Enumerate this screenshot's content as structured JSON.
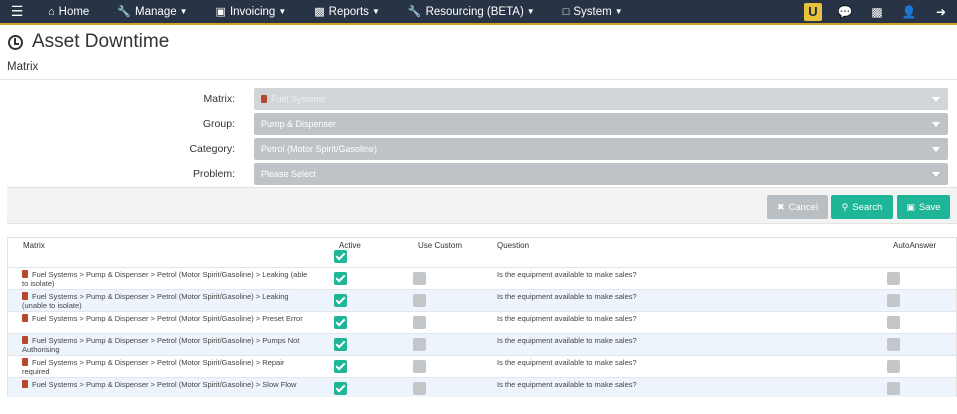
{
  "navbar": {
    "items": [
      {
        "label": "Home",
        "icon": "home-icon",
        "caret": false
      },
      {
        "label": "Manage",
        "icon": "wrench-icon",
        "caret": true
      },
      {
        "label": "Invoicing",
        "icon": "money-icon",
        "caret": true
      },
      {
        "label": "Reports",
        "icon": "bar-chart-icon",
        "caret": true
      },
      {
        "label": "Resourcing (BETA)",
        "icon": "wrench-icon",
        "caret": true
      },
      {
        "label": "System",
        "icon": "monitor-icon",
        "caret": true
      }
    ],
    "right_icons": [
      "logo-u-icon",
      "chat-icon",
      "bar-chart-icon",
      "user-icon",
      "logout-icon"
    ],
    "logo_letter": "U"
  },
  "page": {
    "title": "Asset Downtime",
    "subtitle": "Matrix"
  },
  "form": {
    "matrix_label": "Matrix:",
    "matrix_value": "Fuel Systems",
    "group_label": "Group:",
    "group_value": "Pump & Dispenser",
    "category_label": "Category:",
    "category_value": "Petrol (Motor Spirit/Gasoline)",
    "problem_label": "Problem:",
    "problem_value": "Please Select"
  },
  "actions": {
    "cancel_label": "Cancel",
    "search_label": "Search",
    "save_label": "Save"
  },
  "table": {
    "headers": {
      "matrix": "Matrix",
      "active": "Active",
      "use_custom": "Use Custom",
      "question": "Question",
      "autoanswer": "AutoAnswer"
    },
    "header_active_checked": true,
    "rows": [
      {
        "matrix": "Fuel Systems > Pump & Dispenser > Petrol (Motor Spirit/Gasoline) > Leaking (able to isolate)",
        "active": true,
        "use_custom": false,
        "question": "Is the equipment available to make sales?",
        "autoanswer": false
      },
      {
        "matrix": "Fuel Systems > Pump & Dispenser > Petrol (Motor Spirit/Gasoline) > Leaking (unable to isolate)",
        "active": true,
        "use_custom": false,
        "question": "Is the equipment available to make sales?",
        "autoanswer": false
      },
      {
        "matrix": "Fuel Systems > Pump & Dispenser > Petrol (Motor Spirit/Gasoline) > Preset Error",
        "active": true,
        "use_custom": false,
        "question": "Is the equipment available to make sales?",
        "autoanswer": false
      },
      {
        "matrix": "Fuel Systems > Pump & Dispenser > Petrol (Motor Spirit/Gasoline) > Pumps Not Authorising",
        "active": true,
        "use_custom": false,
        "question": "Is the equipment available to make sales?",
        "autoanswer": false
      },
      {
        "matrix": "Fuel Systems > Pump & Dispenser > Petrol (Motor Spirit/Gasoline) > Repair required",
        "active": true,
        "use_custom": false,
        "question": "Is the equipment available to make sales?",
        "autoanswer": false
      },
      {
        "matrix": "Fuel Systems > Pump & Dispenser > Petrol (Motor Spirit/Gasoline) > Slow Flow",
        "active": true,
        "use_custom": false,
        "question": "Is the equipment available to make sales?",
        "autoanswer": false
      }
    ]
  },
  "colors": {
    "navbar_bg": "#283445",
    "accent_green": "#1fb597",
    "select_bg": "#bfc3c7"
  }
}
